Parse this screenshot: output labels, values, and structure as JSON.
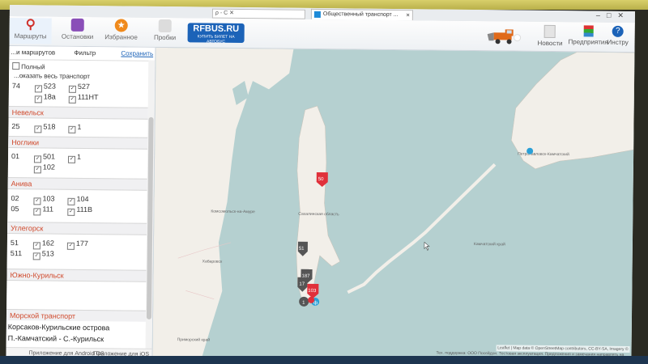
{
  "browser": {
    "url_fragment": "ρ - C ✕",
    "tab_title": "Общественный транспорт ..."
  },
  "header": {
    "nav": [
      {
        "label": "Маршруты",
        "icon": "route-icon"
      },
      {
        "label": "Остановки",
        "icon": "bus-stop-icon"
      },
      {
        "label": "Избранное",
        "icon": "star-icon"
      },
      {
        "label": "Пробки",
        "icon": "traffic-light-icon"
      }
    ],
    "logo_main": "RFBUS.RU",
    "logo_sub": "КУПИТЬ БИЛЕТ НА АВТОБУС",
    "right": [
      {
        "label": "Новости",
        "icon": "news-icon"
      },
      {
        "label": "Предприятия",
        "icon": "enterprise-icon"
      },
      {
        "label": "Инстру",
        "icon": "help-icon"
      }
    ]
  },
  "sidebar": {
    "tab_routes": "...и маршрутов",
    "tab_filter": "Фильтр",
    "save_label": "Сохранить",
    "mode_label": "Полный",
    "show_all": "...оказать весь транспорт",
    "rows_top": [
      "74",
      "523",
      "527",
      "18а",
      "111НТ"
    ],
    "regions": [
      {
        "name": "Невельск",
        "routes": [
          "25",
          "518",
          "1"
        ]
      },
      {
        "name": "Ноглики",
        "routes": [
          "01",
          "501",
          "1",
          "102"
        ]
      },
      {
        "name": "Анива",
        "routes": [
          "02",
          "103",
          "104",
          "05",
          "111",
          "111В"
        ]
      },
      {
        "name": "Углегорск",
        "routes": [
          "51",
          "162",
          "177",
          "511",
          "513"
        ]
      },
      {
        "name": "Южно-Курильск",
        "routes": []
      }
    ],
    "sea_transport": "Морской транспорт",
    "sea_routes": [
      "Корсаков-Курильские острова",
      "П.-Камчатский - С.-Курильск"
    ],
    "android_link": "Приложение для Android OS",
    "ios_link": "Приложение для iOS"
  },
  "map": {
    "places": [
      "Комсомольск-на-Амуре",
      "Сахалинская область",
      "Петропавловск-Камчатский",
      "Хабаровск",
      "Приморский край",
      "Камчатский край"
    ],
    "markers": [
      "50",
      "51",
      "187",
      "17",
      "103",
      "1",
      "ф"
    ],
    "attribution": "Leaflet | Map data © OpenStreetMap contributors, CC-BY-SA, Imagery ©",
    "footer": "Тех. поддержка: ООО Посейдон. Тестовая эксплуатация.   Предложения и замечания направлять на feedback@rfbus.ru"
  },
  "colors": {
    "sea": "#b5d0d0",
    "land": "#f2efe9",
    "region_header": "#d04b2e",
    "marker": "#e0303a",
    "logo_bg": "#1c63b8"
  }
}
